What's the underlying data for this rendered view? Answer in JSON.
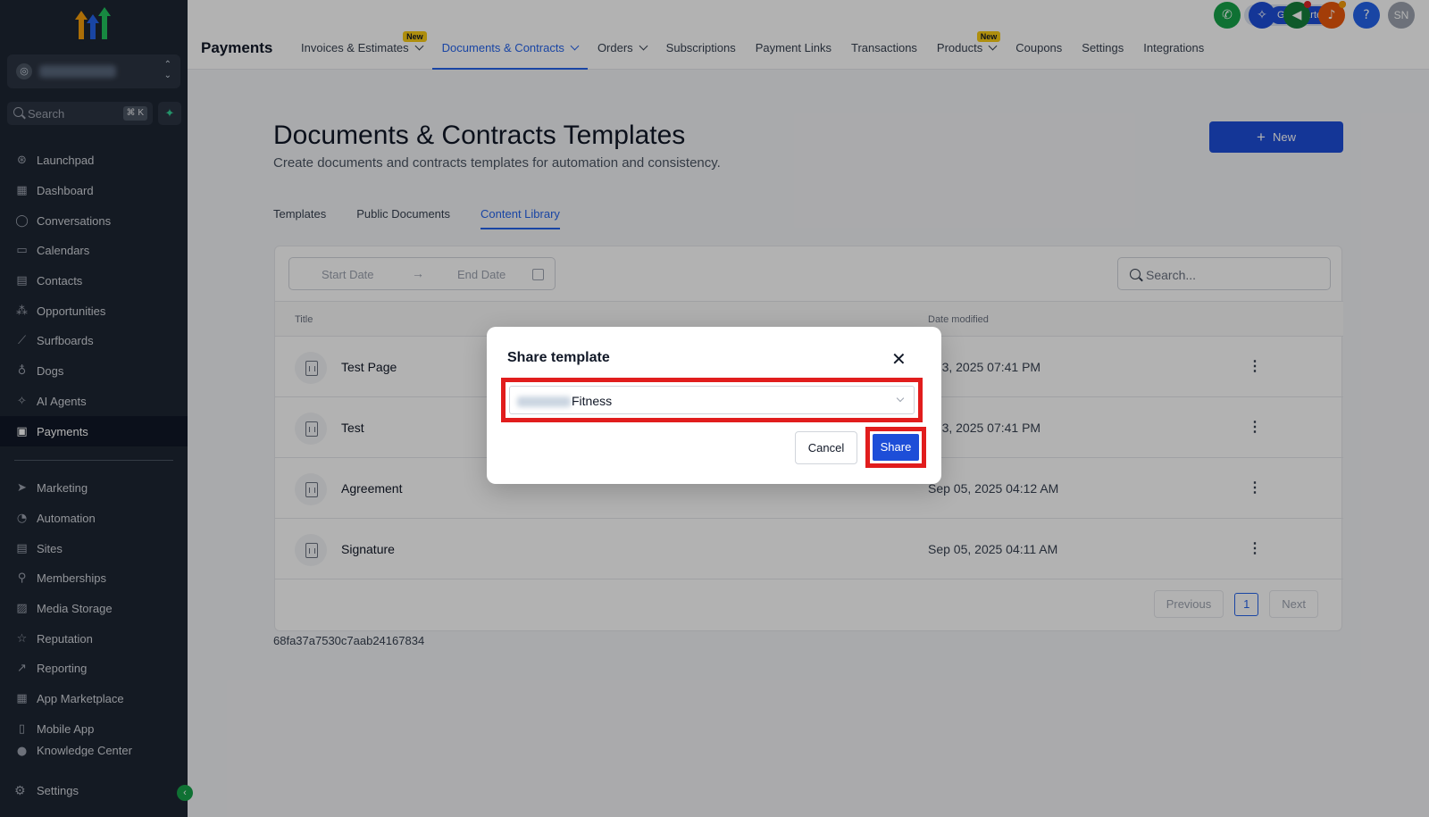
{
  "sidebar": {
    "search_placeholder": "Search",
    "search_shortcut": "⌘ K",
    "items_top": [
      {
        "label": "Launchpad",
        "icon": "rocket-icon"
      },
      {
        "label": "Dashboard",
        "icon": "dashboard-icon"
      },
      {
        "label": "Conversations",
        "icon": "chat-icon"
      },
      {
        "label": "Calendars",
        "icon": "calendar-icon"
      },
      {
        "label": "Contacts",
        "icon": "contacts-icon"
      },
      {
        "label": "Opportunities",
        "icon": "opportunities-icon"
      },
      {
        "label": "Surfboards",
        "icon": "surfboard-icon"
      },
      {
        "label": "Dogs",
        "icon": "dog-icon"
      },
      {
        "label": "AI Agents",
        "icon": "sparkle-icon"
      },
      {
        "label": "Payments",
        "icon": "receipt-icon",
        "active": true
      }
    ],
    "items_bottom": [
      {
        "label": "Marketing",
        "icon": "send-icon"
      },
      {
        "label": "Automation",
        "icon": "automation-icon"
      },
      {
        "label": "Sites",
        "icon": "sites-icon"
      },
      {
        "label": "Memberships",
        "icon": "badge-icon"
      },
      {
        "label": "Media Storage",
        "icon": "image-icon"
      },
      {
        "label": "Reputation",
        "icon": "star-icon"
      },
      {
        "label": "Reporting",
        "icon": "trend-icon"
      },
      {
        "label": "App Marketplace",
        "icon": "apps-icon"
      },
      {
        "label": "Mobile App",
        "icon": "phone-icon"
      },
      {
        "label": "Knowledge Center",
        "icon": "book-icon"
      }
    ],
    "settings_label": "Settings"
  },
  "header": {
    "page_label": "Payments",
    "tabs": [
      {
        "label": "Invoices & Estimates",
        "badge": "New",
        "dropdown": true
      },
      {
        "label": "Documents & Contracts",
        "dropdown": true,
        "active": true
      },
      {
        "label": "Orders",
        "dropdown": true
      },
      {
        "label": "Subscriptions"
      },
      {
        "label": "Payment Links"
      },
      {
        "label": "Transactions"
      },
      {
        "label": "Products",
        "badge": "New",
        "dropdown": true
      },
      {
        "label": "Coupons"
      },
      {
        "label": "Settings"
      },
      {
        "label": "Integrations"
      }
    ],
    "get_started_label": "Get Started",
    "avatar_initials": "SN"
  },
  "main": {
    "title": "Documents & Contracts Templates",
    "subtitle": "Create documents and contracts templates for automation and consistency.",
    "new_button": "New",
    "subtabs": [
      {
        "label": "Templates"
      },
      {
        "label": "Public Documents"
      },
      {
        "label": "Content Library",
        "active": true
      }
    ],
    "filters": {
      "start_date_placeholder": "Start Date",
      "end_date_placeholder": "End Date",
      "search_placeholder": "Search..."
    },
    "table": {
      "columns": [
        "Title",
        "Date modified"
      ],
      "rows": [
        {
          "title": "Test Page",
          "date": "t 23, 2025 07:41 PM"
        },
        {
          "title": "Test",
          "date": "t 23, 2025 07:41 PM"
        },
        {
          "title": "Agreement",
          "date": "Sep 05, 2025 04:12 AM"
        },
        {
          "title": "Signature",
          "date": "Sep 05, 2025 04:11 AM"
        }
      ]
    },
    "pagination": {
      "previous": "Previous",
      "current_page": "1",
      "next": "Next"
    },
    "document_id": "68fa37a7530c7aab24167834"
  },
  "modal": {
    "title": "Share template",
    "selected_value": "Fitness",
    "cancel_label": "Cancel",
    "share_label": "Share"
  },
  "colors": {
    "sidebar_bg": "#1e2633",
    "accent_blue": "#1d4ed8",
    "highlight_red": "#e11d1d",
    "badge_yellow": "#facc15"
  }
}
